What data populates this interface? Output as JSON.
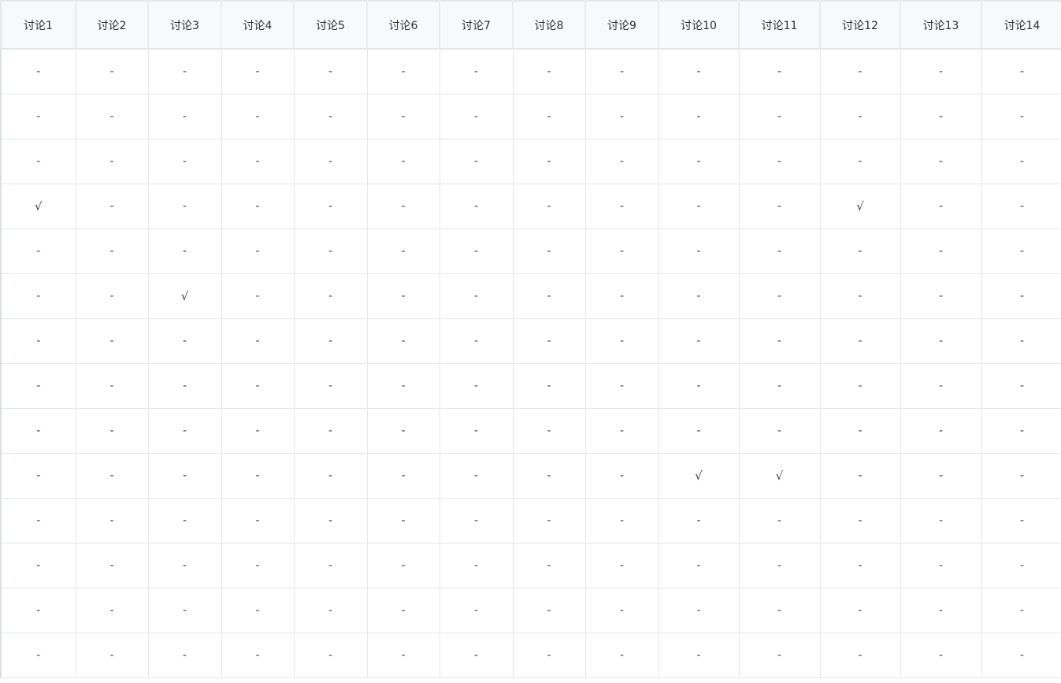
{
  "table": {
    "headers": [
      "讨论1",
      "讨论2",
      "讨论3",
      "讨论4",
      "讨论5",
      "讨论6",
      "讨论7",
      "讨论8",
      "讨论9",
      "讨论10",
      "讨论11",
      "讨论12",
      "讨论13",
      "讨论14"
    ],
    "rows": [
      [
        "-",
        "-",
        "-",
        "-",
        "-",
        "-",
        "-",
        "-",
        "-",
        "-",
        "-",
        "-",
        "-",
        "-"
      ],
      [
        "-",
        "-",
        "-",
        "-",
        "-",
        "-",
        "-",
        "-",
        "-",
        "-",
        "-",
        "-",
        "-",
        "-"
      ],
      [
        "-",
        "-",
        "-",
        "-",
        "-",
        "-",
        "-",
        "-",
        "-",
        "-",
        "-",
        "-",
        "-",
        "-"
      ],
      [
        "√",
        "-",
        "-",
        "-",
        "-",
        "-",
        "-",
        "-",
        "-",
        "-",
        "-",
        "√",
        "-",
        "-"
      ],
      [
        "-",
        "-",
        "-",
        "-",
        "-",
        "-",
        "-",
        "-",
        "-",
        "-",
        "-",
        "-",
        "-",
        "-"
      ],
      [
        "-",
        "-",
        "√",
        "-",
        "-",
        "-",
        "-",
        "-",
        "-",
        "-",
        "-",
        "-",
        "-",
        "-"
      ],
      [
        "-",
        "-",
        "-",
        "-",
        "-",
        "-",
        "-",
        "-",
        "-",
        "-",
        "-",
        "-",
        "-",
        "-"
      ],
      [
        "-",
        "-",
        "-",
        "-",
        "-",
        "-",
        "-",
        "-",
        "-",
        "-",
        "-",
        "-",
        "-",
        "-"
      ],
      [
        "-",
        "-",
        "-",
        "-",
        "-",
        "-",
        "-",
        "-",
        "-",
        "-",
        "-",
        "-",
        "-",
        "-"
      ],
      [
        "-",
        "-",
        "-",
        "-",
        "-",
        "-",
        "-",
        "-",
        "-",
        "√",
        "√",
        "-",
        "-",
        "-"
      ],
      [
        "-",
        "-",
        "-",
        "-",
        "-",
        "-",
        "-",
        "-",
        "-",
        "-",
        "-",
        "-",
        "-",
        "-"
      ],
      [
        "-",
        "-",
        "-",
        "-",
        "-",
        "-",
        "-",
        "-",
        "-",
        "-",
        "-",
        "-",
        "-",
        "-"
      ],
      [
        "-",
        "-",
        "-",
        "-",
        "-",
        "-",
        "-",
        "-",
        "-",
        "-",
        "-",
        "-",
        "-",
        "-"
      ],
      [
        "-",
        "-",
        "-",
        "-",
        "-",
        "-",
        "-",
        "-",
        "-",
        "-",
        "-",
        "-",
        "-",
        "-"
      ]
    ]
  },
  "colors": {
    "header_bg": "#f8f9fb",
    "border": "#e4e6ea",
    "text": "#2d2f33"
  }
}
